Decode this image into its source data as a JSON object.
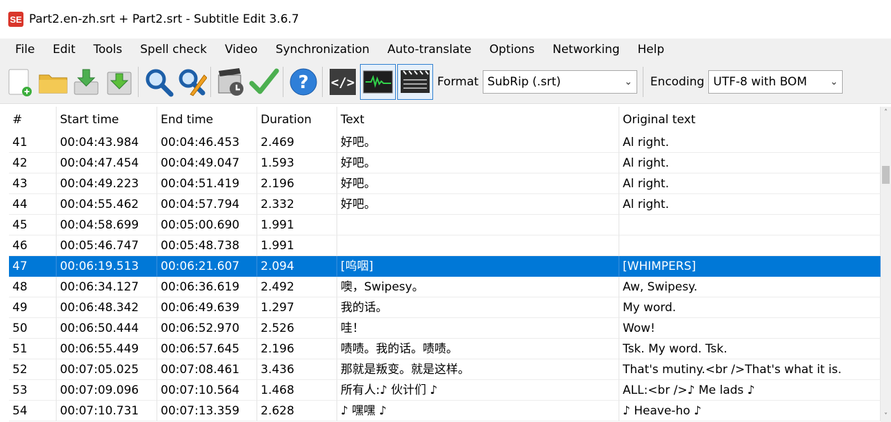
{
  "window": {
    "title": "Part2.en-zh.srt + Part2.srt - Subtitle Edit 3.6.7",
    "app_icon_text": "SE"
  },
  "menu": [
    "File",
    "Edit",
    "Tools",
    "Spell check",
    "Video",
    "Synchronization",
    "Auto-translate",
    "Options",
    "Networking",
    "Help"
  ],
  "toolbar": {
    "format_label": "Format",
    "format_value": "SubRip (.srt)",
    "encoding_label": "Encoding",
    "encoding_value": "UTF-8 with BOM",
    "icons": [
      "new-file-icon",
      "open-folder-icon",
      "import-icon",
      "download-icon",
      "find-icon",
      "replace-icon",
      "visual-sync-icon",
      "spell-check-icon",
      "help-icon",
      "source-view-icon",
      "waveform-icon",
      "video-icon"
    ]
  },
  "colors": {
    "selection": "#0078d7",
    "accent_icon": "#d9362b"
  },
  "grid": {
    "columns": [
      "#",
      "Start time",
      "End time",
      "Duration",
      "Text",
      "Original text"
    ],
    "selected_row": 47,
    "rows": [
      [
        "41",
        "00:04:43.984",
        "00:04:46.453",
        "2.469",
        "好吧。",
        "Al right."
      ],
      [
        "42",
        "00:04:47.454",
        "00:04:49.047",
        "1.593",
        "好吧。",
        "Al right."
      ],
      [
        "43",
        "00:04:49.223",
        "00:04:51.419",
        "2.196",
        "好吧。",
        "Al right."
      ],
      [
        "44",
        "00:04:55.462",
        "00:04:57.794",
        "2.332",
        "好吧。",
        "Al right."
      ],
      [
        "45",
        "00:04:58.699",
        "00:05:00.690",
        "1.991",
        "",
        ""
      ],
      [
        "46",
        "00:05:46.747",
        "00:05:48.738",
        "1.991",
        "",
        ""
      ],
      [
        "47",
        "00:06:19.513",
        "00:06:21.607",
        "2.094",
        "[呜咽]",
        "[WHIMPERS]"
      ],
      [
        "48",
        "00:06:34.127",
        "00:06:36.619",
        "2.492",
        "噢，Swipesy。",
        "Aw, Swipesy."
      ],
      [
        "49",
        "00:06:48.342",
        "00:06:49.639",
        "1.297",
        "我的话。",
        "My word."
      ],
      [
        "50",
        "00:06:50.444",
        "00:06:52.970",
        "2.526",
        "哇！",
        "Wow!"
      ],
      [
        "51",
        "00:06:55.449",
        "00:06:57.645",
        "2.196",
        "啧啧。我的话。啧啧。",
        "Tsk. My word. Tsk."
      ],
      [
        "52",
        "00:07:05.025",
        "00:07:08.461",
        "3.436",
        "那就是叛变。就是这样。",
        "That's mutiny.<br />That's what it is."
      ],
      [
        "53",
        "00:07:09.096",
        "00:07:10.564",
        "1.468",
        "所有人:♪ 伙计们 ♪",
        "ALL:<br />♪ Me lads ♪"
      ],
      [
        "54",
        "00:07:10.731",
        "00:07:13.359",
        "2.628",
        "♪ 嘿嘿 ♪",
        "♪ Heave-ho ♪"
      ]
    ]
  }
}
